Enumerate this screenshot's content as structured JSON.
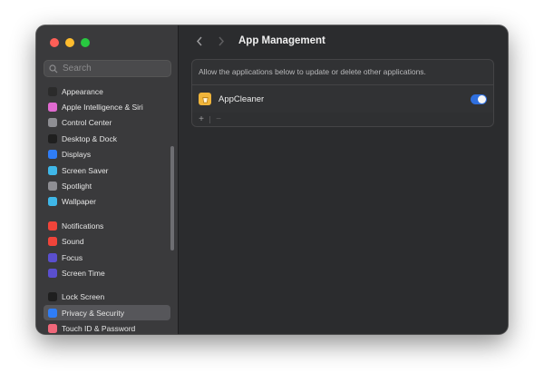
{
  "window": {
    "title": "App Management"
  },
  "sidebar": {
    "search_placeholder": "Search",
    "groups": [
      [
        {
          "label": "Appearance",
          "icon": "appearance-icon",
          "color": "#2b2b2b"
        },
        {
          "label": "Apple Intelligence & Siri",
          "icon": "siri-icon",
          "color": "#e06ad0"
        },
        {
          "label": "Control Center",
          "icon": "control-center-icon",
          "color": "#8e8e93"
        },
        {
          "label": "Desktop & Dock",
          "icon": "dock-icon",
          "color": "#1f1f1f"
        },
        {
          "label": "Displays",
          "icon": "displays-icon",
          "color": "#2f7df6"
        },
        {
          "label": "Screen Saver",
          "icon": "screen-saver-icon",
          "color": "#3fb7e8"
        },
        {
          "label": "Spotlight",
          "icon": "spotlight-icon",
          "color": "#8e8e93"
        },
        {
          "label": "Wallpaper",
          "icon": "wallpaper-icon",
          "color": "#3fb7e8"
        }
      ],
      [
        {
          "label": "Notifications",
          "icon": "notifications-icon",
          "color": "#f0443a"
        },
        {
          "label": "Sound",
          "icon": "sound-icon",
          "color": "#f0443a"
        },
        {
          "label": "Focus",
          "icon": "focus-icon",
          "color": "#5a4fcf"
        },
        {
          "label": "Screen Time",
          "icon": "screen-time-icon",
          "color": "#5a4fcf"
        }
      ],
      [
        {
          "label": "Lock Screen",
          "icon": "lock-screen-icon",
          "color": "#1f1f1f"
        },
        {
          "label": "Privacy & Security",
          "icon": "privacy-icon",
          "color": "#2f7df6",
          "selected": true
        },
        {
          "label": "Touch ID & Password",
          "icon": "touch-id-icon",
          "color": "#f0677a"
        }
      ]
    ]
  },
  "main": {
    "description": "Allow the applications below to update or delete other applications.",
    "apps": [
      {
        "name": "AppCleaner",
        "enabled": true
      }
    ],
    "add_label": "+",
    "remove_label": "−"
  },
  "colors": {
    "accent": "#2f6fde",
    "sidebar_bg": "#3a3a3c",
    "main_bg": "#2b2c2e"
  }
}
